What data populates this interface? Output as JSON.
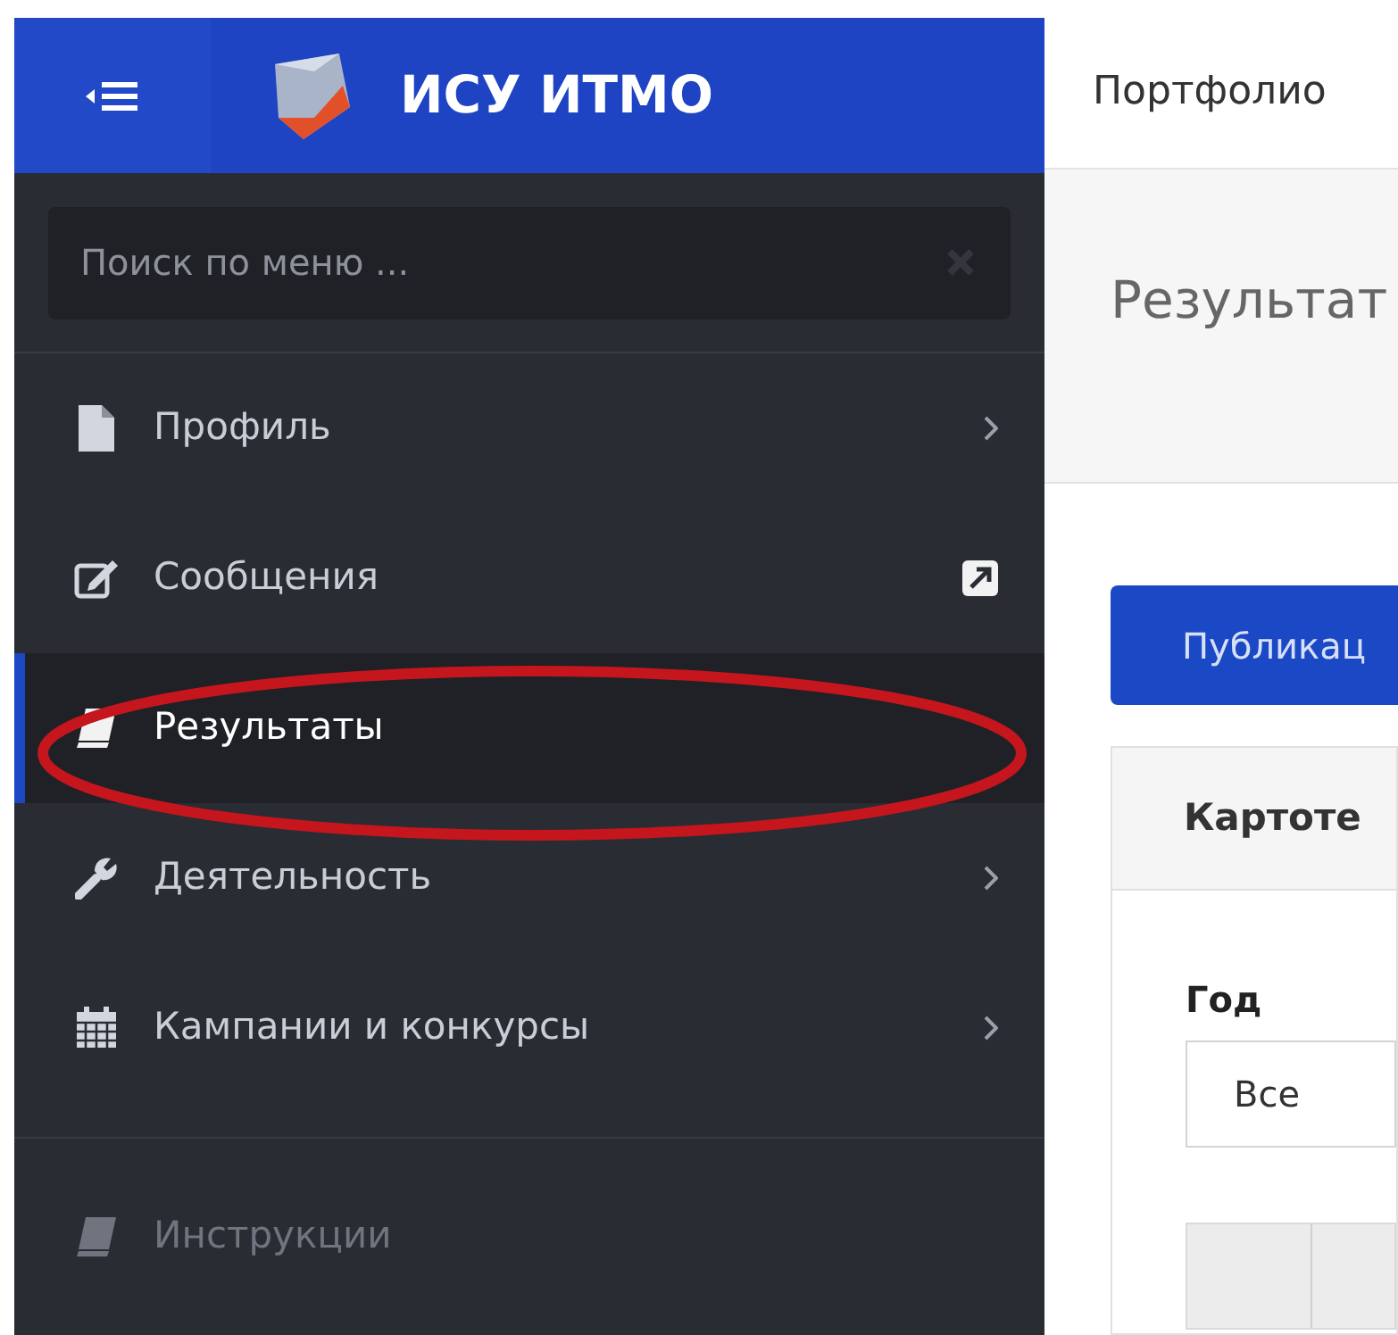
{
  "header": {
    "app_title": "ИСУ ИТМО",
    "breadcrumb": "Портфолио"
  },
  "search": {
    "placeholder": "Поиск по меню ..."
  },
  "menu": [
    {
      "kind": "doc",
      "label": "Профиль",
      "has_submenu": true,
      "external": false,
      "selected": false,
      "disabled": false
    },
    {
      "kind": "edit",
      "label": "Сообщения",
      "has_submenu": false,
      "external": true,
      "selected": false,
      "disabled": false
    },
    {
      "kind": "book",
      "label": "Результаты",
      "has_submenu": false,
      "external": false,
      "selected": true,
      "disabled": false
    },
    {
      "kind": "wrench",
      "label": "Деятельность",
      "has_submenu": true,
      "external": false,
      "selected": false,
      "disabled": false
    },
    {
      "kind": "calendar",
      "label": "Кампании и конкурсы",
      "has_submenu": true,
      "external": false,
      "selected": false,
      "disabled": false
    },
    {
      "kind": "book",
      "label": "Инструкции",
      "has_submenu": false,
      "external": false,
      "selected": false,
      "disabled": true
    }
  ],
  "page_title": "Результат",
  "tab_button": "Публикац",
  "card": {
    "title": "Картоте",
    "filter_label": "Год",
    "filter_value": "Все"
  }
}
